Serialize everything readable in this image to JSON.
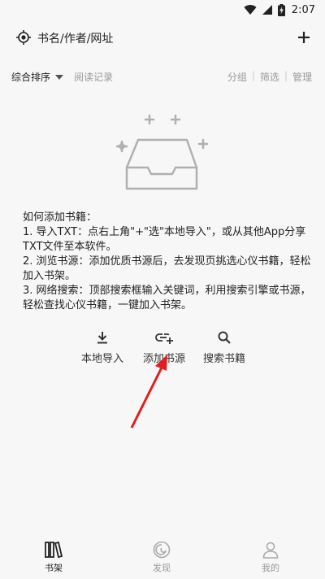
{
  "status": {
    "time": "2:07"
  },
  "search": {
    "placeholder": "书名/作者/网址"
  },
  "tabs": {
    "sort": "综合排序",
    "history": "阅读记录",
    "group": "分组",
    "filter": "筛选",
    "manage": "管理",
    "sep": "|"
  },
  "help": {
    "title": "如何添加书籍：",
    "lines": [
      "1. 导入TXT：点右上角\"+\"选\"本地导入\"，或从其他App分享TXT文件至本软件。",
      "2. 浏览书源：添加优质书源后，去发现页挑选心仪书籍，轻松加入书架。",
      "3. 网络搜索：顶部搜索框输入关键词，利用搜索引擎或书源，轻松查找心仪书籍，一键加入书架。"
    ]
  },
  "actions": {
    "local_import": "本地导入",
    "add_source": "添加书源",
    "search_books": "搜索书籍"
  },
  "nav": {
    "shelf": "书架",
    "discover": "发现",
    "mine": "我的"
  },
  "colors": {
    "accent": "#222222",
    "muted": "#999999",
    "arrow": "#e02020",
    "icon_gray": "#b0b0b0"
  },
  "icons": {
    "wifi": "wifi-icon",
    "signal": "signal-icon",
    "battery": "battery-charging-icon",
    "locate": "locate-icon",
    "add": "plus-icon",
    "download": "download-icon",
    "link": "link-add-icon",
    "search": "search-icon",
    "shelf": "bookshelf-icon",
    "discover": "compass-icon",
    "mine": "person-icon"
  }
}
